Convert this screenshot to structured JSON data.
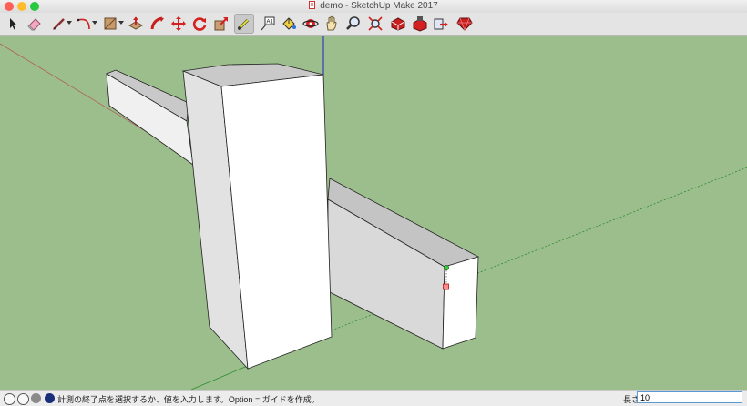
{
  "window": {
    "title": "demo - SketchUp Make 2017",
    "traffic_lights": [
      {
        "name": "close",
        "color": "#fd5f57"
      },
      {
        "name": "minimize",
        "color": "#febc2e"
      },
      {
        "name": "zoom",
        "color": "#28c840"
      }
    ]
  },
  "toolbar": {
    "tools": [
      {
        "name": "select-icon"
      },
      {
        "name": "eraser-icon"
      },
      {
        "name": "line-icon",
        "dropdown": true
      },
      {
        "name": "arc-icon",
        "dropdown": true
      },
      {
        "name": "shape-icon",
        "dropdown": true
      },
      {
        "name": "push-pull-icon"
      },
      {
        "name": "follow-me-icon"
      },
      {
        "name": "move-icon"
      },
      {
        "name": "rotate-icon"
      },
      {
        "name": "scale-icon"
      },
      {
        "name": "tape-measure-icon",
        "active": true
      },
      {
        "name": "text-icon"
      },
      {
        "name": "paint-bucket-icon"
      },
      {
        "name": "orbit-icon"
      },
      {
        "name": "pan-icon"
      },
      {
        "name": "zoom-icon"
      },
      {
        "name": "zoom-extents-icon"
      },
      {
        "name": "3d-warehouse-icon"
      },
      {
        "name": "extension-warehouse-icon"
      },
      {
        "name": "share-model-icon"
      },
      {
        "name": "ruby-icon"
      }
    ]
  },
  "colors": {
    "ground": "#9cbe8d",
    "face_light": "#ffffff",
    "face_shade": "#d9d9d9",
    "face_dark": "#c4c4c4",
    "red_axis": "#c0504d",
    "green_axis": "#2e8b2e",
    "blue_axis": "#2020c0"
  },
  "status": {
    "message": "計測の終了点を選択するか、値を入力します。Option = ガイドを作成。",
    "measurement_label": "長さ",
    "measurement_value": "10"
  }
}
